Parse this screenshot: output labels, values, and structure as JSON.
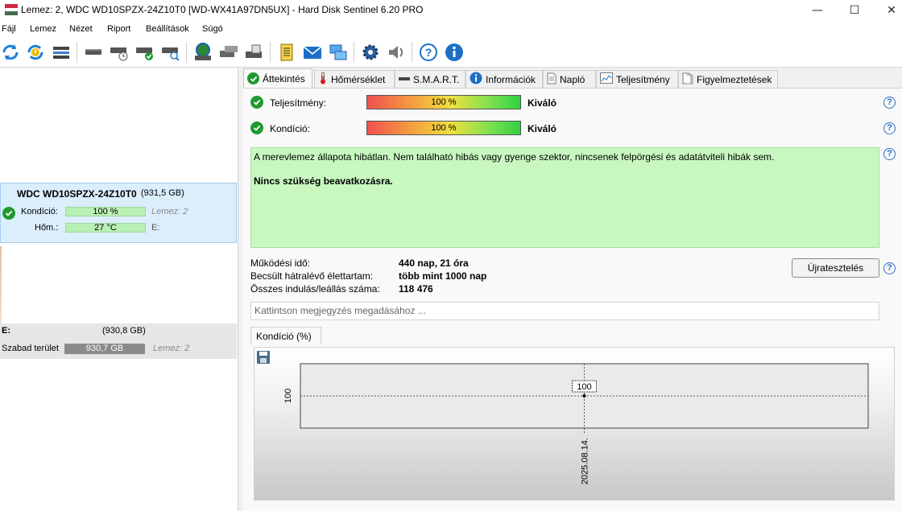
{
  "window": {
    "title": "Lemez: 2, WDC WD10SPZX-24Z10T0 [WD-WX41A97DN5UX]  -  Hard Disk Sentinel 6.20 PRO",
    "minimize_glyph": "—",
    "maximize_glyph": "☐",
    "close_glyph": "✕"
  },
  "menu": [
    "Fájl",
    "Lemez",
    "Nézet",
    "Riport",
    "Beállítások",
    "Súgó"
  ],
  "toolbar_icons": [
    "refresh-icon",
    "refresh-warning-icon",
    "disk-list-icon",
    "disk-icon",
    "disk-clock-icon",
    "disk-ok-icon",
    "disk-search-icon",
    "globe-disk-icon",
    "disk-transfer-icon",
    "disk-test-icon",
    "report-icon",
    "email-icon",
    "network-icon",
    "settings-icon",
    "speaker-icon",
    "help-icon",
    "info-icon"
  ],
  "left": {
    "disk_name": "WDC WD10SPZX-24Z10T0",
    "disk_size": "(931,5 GB)",
    "condition_label": "Kondíció:",
    "condition_value": "100 %",
    "disk_ref": "Lemez: 2",
    "temp_label": "Hőm.:",
    "temp_value": "27 °C",
    "drive_letter": "E:",
    "partition_letter": "E:",
    "partition_size": "(930,8 GB)",
    "free_label": "Szabad terület",
    "free_value": "930,7 GB",
    "partition_disk_ref": "Lemez: 2"
  },
  "tabs": [
    "Áttekintés",
    "Hőmérséklet",
    "S.M.A.R.T.",
    "Információk",
    "Napló",
    "Teljesítmény",
    "Figyelmeztetések"
  ],
  "overview": {
    "performance_label": "Teljesítmény:",
    "performance_value": "100 %",
    "performance_rating": "Kiváló",
    "health_label": "Kondíció:",
    "health_value": "100 %",
    "health_rating": "Kiváló",
    "status_text": "A merevlemez állapota hibátlan. Nem található hibás vagy gyenge szektor, nincsenek felpörgési és adatátviteli hibák sem.",
    "status_action": "Nincs szükség beavatkozásra.",
    "uptime_label": "Működési idő:",
    "uptime_value": "440 nap, 21 óra",
    "lifetime_label": "Becsült hátralévő élettartam:",
    "lifetime_value": "több mint 1000 nap",
    "startstop_label": "Összes indulás/leállás száma:",
    "startstop_value": "118 476",
    "retest_button": "Újratesztelés",
    "remark_placeholder": "Kattintson megjegyzés megadásához ...",
    "help_glyph": "?"
  },
  "chart_tab": "Kondíció  (%)",
  "chart_data": {
    "type": "line",
    "title": "",
    "x": [
      "2025.08.14."
    ],
    "series": [
      {
        "values": [
          100
        ]
      }
    ],
    "y_tick_labels": [
      "100"
    ],
    "x_tick_labels": [
      "2025.08.14."
    ],
    "data_labels": [
      "100"
    ],
    "grid": true
  },
  "colors": {
    "ok_green": "#1f9a2f",
    "status_bg": "#c8f8c0",
    "selection_bg": "#dbeefc",
    "help_blue": "#2a6fc9"
  }
}
